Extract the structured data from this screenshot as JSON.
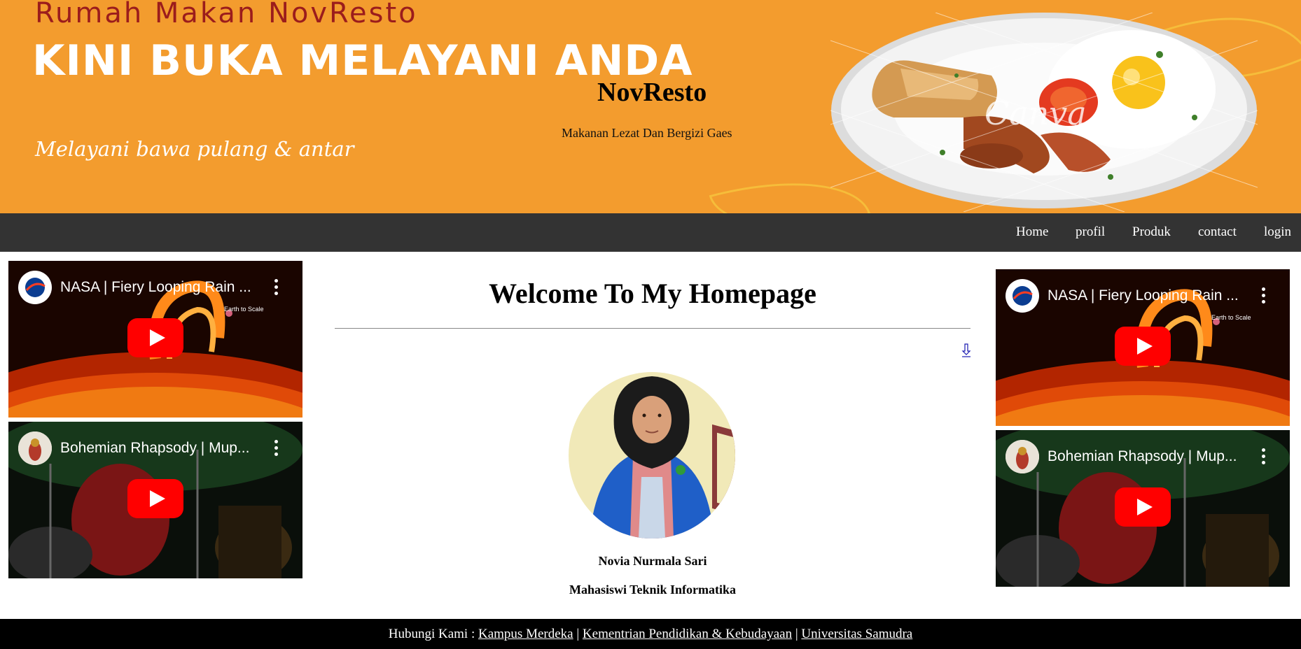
{
  "banner": {
    "brand": "Rumah Makan NovResto",
    "headline": "KINI BUKA MELAYANI ANDA",
    "tagline": "Melayani bawa pulang & antar",
    "watermark": "Canva"
  },
  "site": {
    "title": "NovResto",
    "subtitle": "Makanan Lezat Dan Bergizi Gaes"
  },
  "nav": {
    "items": [
      "Home",
      "profil",
      "Produk",
      "contact",
      "login"
    ]
  },
  "videos": {
    "left": [
      {
        "title": "NASA | Fiery Looping Rain ...",
        "caption": "Earth to Scale",
        "icon": "nasa-logo-icon"
      },
      {
        "title": "Bohemian Rhapsody | Mup...",
        "icon": "muppets-avatar-icon"
      }
    ],
    "right": [
      {
        "title": "NASA | Fiery Looping Rain ...",
        "caption": "Earth to Scale",
        "icon": "nasa-logo-icon"
      },
      {
        "title": "Bohemian Rhapsody | Mup...",
        "icon": "muppets-avatar-icon"
      }
    ]
  },
  "main": {
    "heading": "Welcome To My Homepage",
    "person_name": "Novia Nurmala Sari",
    "person_role": "Mahasiswi Teknik Informatika"
  },
  "footer": {
    "prefix": "Hubungi Kami :",
    "links": [
      "Kampus Merdeka",
      "Kementrian Pendidikan & Kebudayaan",
      "Universitas Samudra"
    ],
    "separator": "|"
  },
  "colors": {
    "banner_orange": "#f39c2e",
    "brand_red": "#9b1c1c",
    "nav_bg": "#333333",
    "footer_bg": "#000000",
    "youtube_red": "#ff0000"
  }
}
